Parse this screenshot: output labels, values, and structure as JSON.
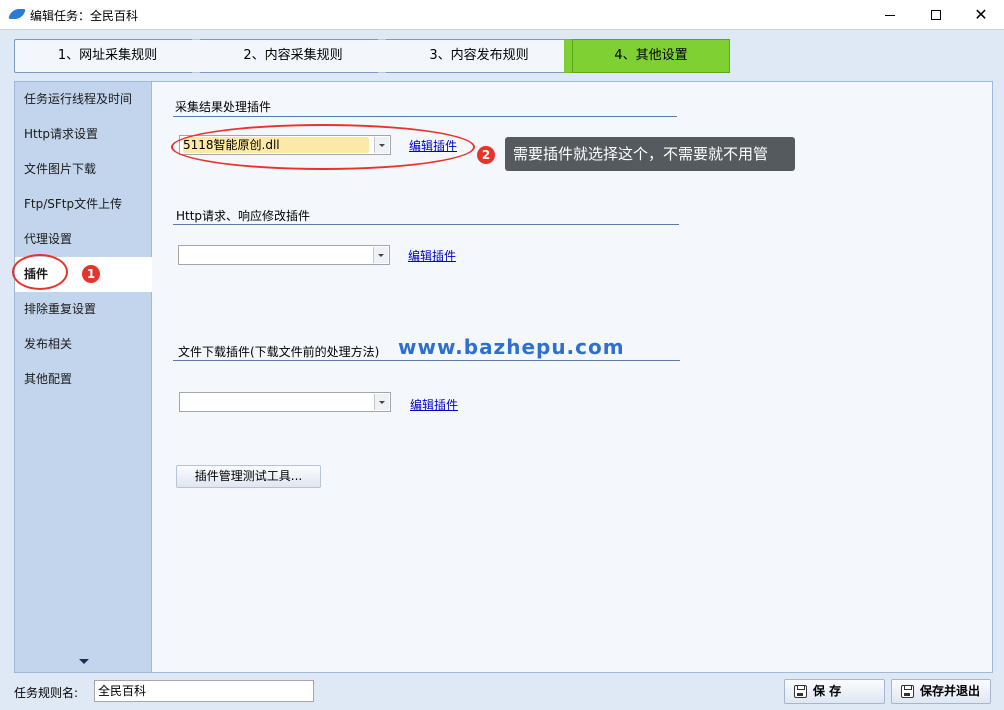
{
  "window": {
    "title": "编辑任务：全民百科",
    "controls": {
      "minimize": "minimize",
      "maximize": "maximize",
      "close": "✕"
    }
  },
  "steps": [
    {
      "label": "1、网址采集规则",
      "active": false
    },
    {
      "label": "2、内容采集规则",
      "active": false
    },
    {
      "label": "3、内容发布规则",
      "active": false
    },
    {
      "label": "4、其他设置",
      "active": true
    }
  ],
  "sidebar": {
    "items": [
      {
        "label": "任务运行线程及时间",
        "active": false
      },
      {
        "label": "Http请求设置",
        "active": false
      },
      {
        "label": "文件图片下载",
        "active": false
      },
      {
        "label": "Ftp/SFtp文件上传",
        "active": false
      },
      {
        "label": "代理设置",
        "active": false
      },
      {
        "label": "插件",
        "active": true
      },
      {
        "label": "排除重复设置",
        "active": false
      },
      {
        "label": "发布相关",
        "active": false
      },
      {
        "label": "其他配置",
        "active": false
      }
    ]
  },
  "main": {
    "section1": {
      "title": "采集结果处理插件",
      "selected": "5118智能原创.dll",
      "edit_link": "编辑插件"
    },
    "section2": {
      "title": "Http请求、响应修改插件",
      "selected": "",
      "edit_link": "编辑插件"
    },
    "section3": {
      "title": "文件下载插件(下载文件前的处理方法)",
      "selected": "",
      "edit_link": "编辑插件"
    },
    "tool_button": "插件管理测试工具..."
  },
  "annotations": {
    "badge1": "1",
    "badge2": "2",
    "callout": "需要插件就选择这个，不需要就不用管",
    "watermark": "www.bazhepu.com",
    "accent_color": "#e8322c"
  },
  "bottom": {
    "rule_name_label": "任务规则名:",
    "rule_name_value": "全民百科",
    "save_label": "保 存",
    "save_exit_label": "保存并退出"
  },
  "colors": {
    "active_step": "#7fd032",
    "sidebar_bg": "#c3d5ec",
    "link": "#0000c8"
  }
}
